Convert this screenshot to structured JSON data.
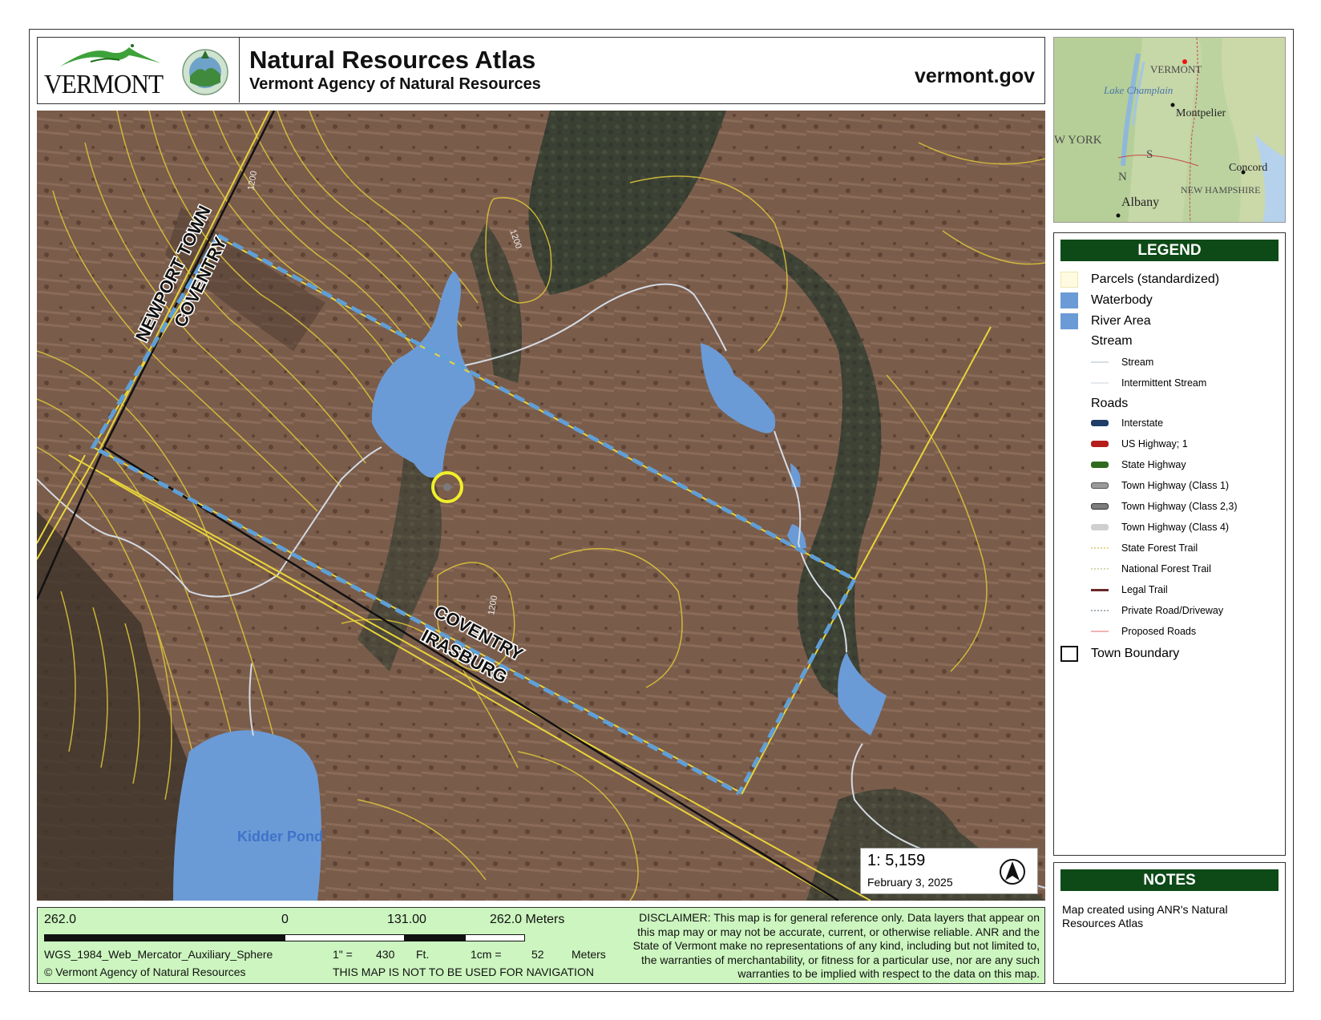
{
  "header": {
    "logo_text": "VERMONT",
    "title": "Natural Resources Atlas",
    "subtitle": "Vermont Agency of Natural Resources",
    "site": "vermont.gov"
  },
  "locator": {
    "labels": [
      "VERMONT",
      "Lake Champlain",
      "Montpelier",
      "W YORK",
      "Concord",
      "NEW HAMPSHIRE",
      "Albany",
      "N",
      "S"
    ]
  },
  "map": {
    "labels": {
      "newport_town": "NEWPORT TOWN",
      "coventry_top": "COVENTRY",
      "coventry_bottom": "COVENTRY",
      "irasburg": "IRASBURG",
      "kidder_pond": "Kidder Pond",
      "contour_1": "1200",
      "contour_2": "1200",
      "contour_3": "1200"
    },
    "scale": "1:  5,159",
    "date": "February 3, 2025",
    "north_icon": "north-arrow-icon"
  },
  "legend": {
    "title": "LEGEND",
    "items": [
      {
        "label": "Parcels (standardized)",
        "color": "#fffbe0"
      },
      {
        "label": "Waterbody",
        "color": "#6b9bd6"
      },
      {
        "label": "River Area",
        "color": "#6b9bd6"
      }
    ],
    "stream_group": "Stream",
    "stream_items": [
      {
        "label": "Stream",
        "color": "#d7dde6"
      },
      {
        "label": "Intermittent Stream",
        "color": "#e5e8ee"
      }
    ],
    "roads_group": "Roads",
    "road_items": [
      {
        "label": "Interstate",
        "color": "#1f3d66"
      },
      {
        "label": "US Highway; 1",
        "color": "#b51d1d"
      },
      {
        "label": "State Highway",
        "color": "#2f6a1e"
      },
      {
        "label": "Town Highway (Class 1)",
        "color": "#9a9a9a"
      },
      {
        "label": "Town Highway (Class 2,3)",
        "color": "#7d7d7d"
      },
      {
        "label": "Town Highway (Class 4)",
        "color": "#cfcfcf"
      },
      {
        "label": "State Forest Trail",
        "color": "#e2d690"
      },
      {
        "label": "National Forest Trail",
        "color": "#d8d8b0"
      },
      {
        "label": "Legal Trail",
        "color": "#6b2828"
      },
      {
        "label": "Private Road/Driveway",
        "color": "#a8b0b8"
      },
      {
        "label": "Proposed Roads",
        "color": "#f0b4b4"
      }
    ],
    "town_boundary": "Town Boundary"
  },
  "notes": {
    "title": "NOTES",
    "text": "Map created using ANR's Natural Resources Atlas"
  },
  "footer": {
    "scale_left": "262.0",
    "scale_zero": "0",
    "scale_mid": "131.00",
    "scale_right": "262.0 Meters",
    "projection": "WGS_1984_Web_Mercator_Auxiliary_Sphere",
    "copyright": "© Vermont Agency of Natural Resources",
    "inch_label": "1\" =",
    "inch_value": "430",
    "inch_unit": "Ft.",
    "cm_label": "1cm =",
    "cm_value": "52",
    "cm_unit": "Meters",
    "nav_warning": "THIS MAP IS NOT TO BE USED FOR NAVIGATION",
    "disclaimer": "DISCLAIMER: This map is for general reference only. Data layers that appear on this map may or may not be accurate, current, or otherwise reliable. ANR and the State of Vermont make no representations of any kind, including but not limited to, the warranties of merchantability, or fitness for a particular use, nor are any such warranties to be implied with respect to the data on this map."
  }
}
